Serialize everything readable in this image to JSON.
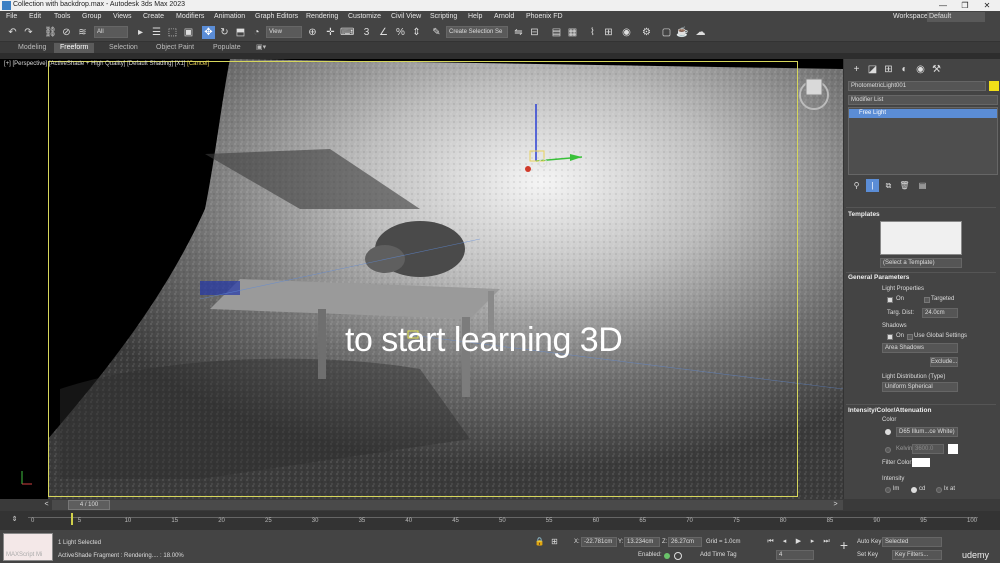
{
  "window": {
    "title": "Collection with backdrop.max - Autodesk 3ds Max 2023",
    "buttons": [
      "—",
      "❐",
      "✕"
    ]
  },
  "menu": {
    "items": [
      "File",
      "Edit",
      "Tools",
      "Group",
      "Views",
      "Create",
      "Modifiers",
      "Animation",
      "Graph Editors",
      "Rendering",
      "Customize",
      "Civil View",
      "Scripting",
      "Help",
      "Arnold",
      "Phoenix FD"
    ],
    "workspaces_label": "Workspaces:",
    "workspaces_value": "Default"
  },
  "toolbar": {
    "selection_filter": "All",
    "ref_coord": "View",
    "selection_set": "Create Selection Se"
  },
  "ribbon": {
    "tabs": [
      "Modeling",
      "Freeform",
      "Selection",
      "Object Paint",
      "Populate"
    ],
    "selected": "Freeform"
  },
  "viewport": {
    "label_parts": [
      "[+]",
      "[Perspective]",
      "[ActiveShade + High Quality]",
      "[Default Shading]",
      "[X1]"
    ],
    "cancel_label": "[Cancel]",
    "caption": "to start learning 3D"
  },
  "command_panel": {
    "object_name": "PhotometricLight001",
    "object_color": "#f2e018",
    "modifier_list": "Modifier List",
    "stack_item": "Free Light",
    "templates": {
      "title": "Templates",
      "select": "(Select a Template)"
    },
    "general": {
      "title": "General Parameters",
      "light_properties": "Light Properties",
      "on": "On",
      "targeted": "Targeted",
      "targ_dist_label": "Targ. Dist:",
      "targ_dist_value": "24.0cm",
      "shadows": "Shadows",
      "shadows_on": "On",
      "use_global": "Use Global Settings",
      "shadow_type": "Area Shadows",
      "exclude": "Exclude...",
      "distribution_label": "Light Distribution (Type)",
      "distribution_value": "Uniform Spherical"
    },
    "intensity": {
      "title": "Intensity/Color/Attenuation",
      "color_label": "Color",
      "color_preset": "D65 Illum...ce White)",
      "kelvin_label": "Kelvin:",
      "kelvin_value": "3600.0",
      "filter_label": "Filter Color:",
      "intensity_label": "Intensity",
      "units": [
        "lm",
        "cd",
        "lx at"
      ]
    }
  },
  "timeline": {
    "frame_counter": "4 / 100",
    "current_frame": 4,
    "total_frames": 100,
    "ticks": [
      "0",
      "5",
      "10",
      "15",
      "20",
      "25",
      "30",
      "35",
      "40",
      "45",
      "50",
      "55",
      "60",
      "65",
      "70",
      "75",
      "80",
      "85",
      "90",
      "95",
      "100"
    ]
  },
  "status": {
    "maxscript": "MAXScript Mi",
    "selected": "1 Light Selected",
    "rendering": "ActiveShade Fragment : Rendering.... : 18.00%",
    "x_label": "X:",
    "x_value": "-22.781cm",
    "y_label": "Y:",
    "y_value": "13.234cm",
    "z_label": "Z:",
    "z_value": "26.27cm",
    "grid": "Grid = 1.0cm",
    "enabled_label": "Enabled:",
    "add_time_tag": "Add Time Tag",
    "auto_key": "Auto Key",
    "auto_key_value": "Selected",
    "set_key": "Set Key",
    "key_filters": "Key Filters...",
    "frame_field": "4",
    "watermark": "udemy"
  }
}
